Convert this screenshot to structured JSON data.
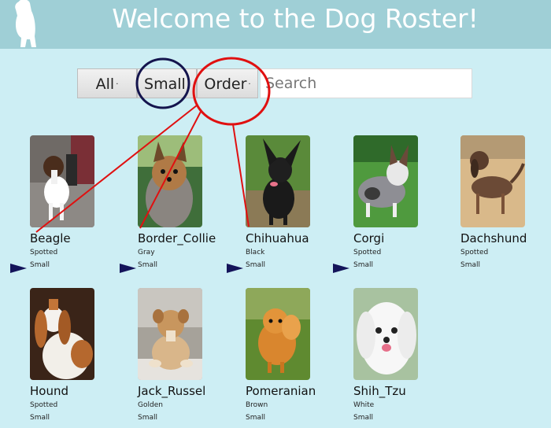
{
  "header": {
    "title": "Welcome to the Dog Roster!",
    "bg_color": "#9fcfd6"
  },
  "toolbar": {
    "buttons": [
      {
        "label": "All",
        "marker": "·"
      },
      {
        "label": "Small",
        "marker": "·"
      },
      {
        "label": "Order",
        "marker": "·"
      }
    ],
    "search_placeholder": "Search"
  },
  "dogs": [
    {
      "name": "Beagle",
      "color": "Spotted",
      "size": "Small"
    },
    {
      "name": "Border_Collie",
      "color": "Gray",
      "size": "Small"
    },
    {
      "name": "Chihuahua",
      "color": "Black",
      "size": "Small"
    },
    {
      "name": "Corgi",
      "color": "Spotted",
      "size": "Small"
    },
    {
      "name": "Dachshund",
      "color": "Spotted",
      "size": "Small"
    },
    {
      "name": "Hound",
      "color": "Spotted",
      "size": "Small"
    },
    {
      "name": "Jack_Russel",
      "color": "Golden",
      "size": "Small"
    },
    {
      "name": "Pomeranian",
      "color": "Brown",
      "size": "Small"
    },
    {
      "name": "Shih_Tzu",
      "color": "White",
      "size": "Small"
    }
  ],
  "annotation_colors": {
    "circle_small": "#14144d",
    "circle_order": "#e01010",
    "arrows": "#14145a"
  }
}
